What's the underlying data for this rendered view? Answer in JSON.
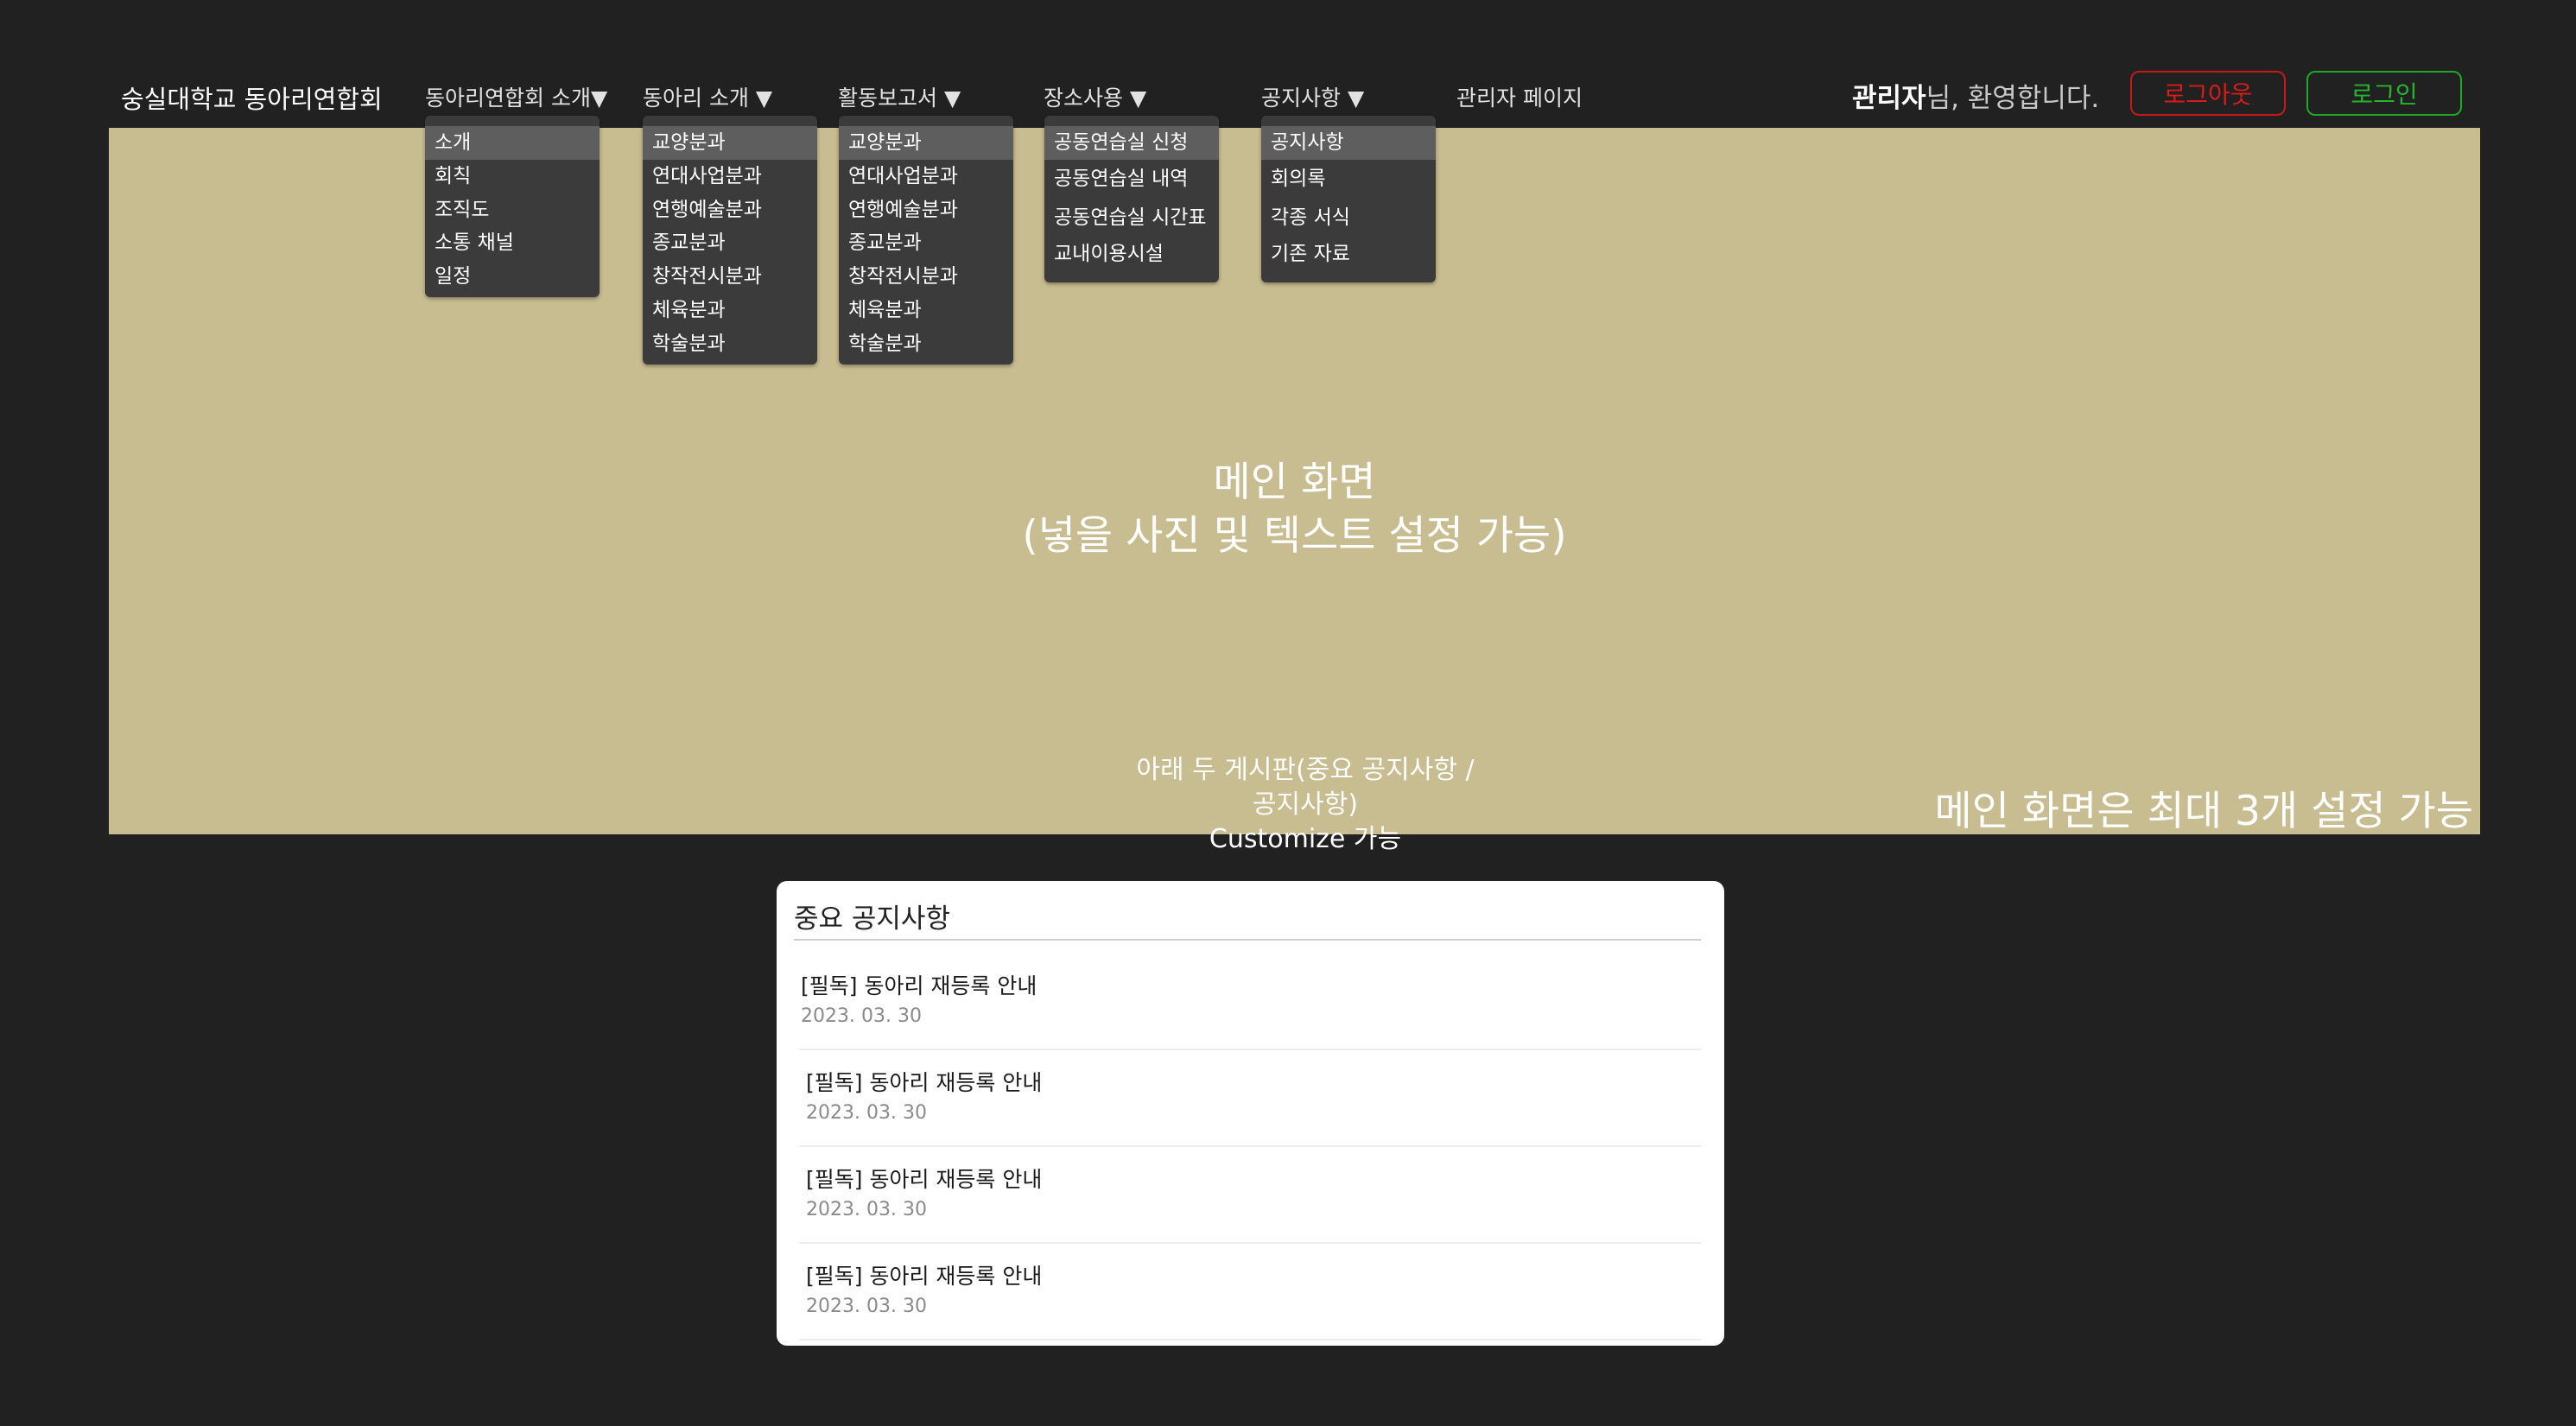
{
  "header": {
    "logo": "숭실대학교 동아리연합회",
    "nav": [
      {
        "label": "동아리연합회 소개▼"
      },
      {
        "label": "동아리 소개 ▼"
      },
      {
        "label": "활동보고서 ▼"
      },
      {
        "label": "장소사용 ▼"
      },
      {
        "label": "공지사항 ▼"
      },
      {
        "label": "관리자 페이지"
      }
    ],
    "welcome_name": "관리자",
    "welcome_suffix": "님, 환영합니다.",
    "logout_label": "로그아웃",
    "login_label": "로그인"
  },
  "dropdowns": {
    "intro": [
      "소개",
      "회칙",
      "조직도",
      "소통 채널",
      "일정"
    ],
    "clubs": [
      "교양분과",
      "연대사업분과",
      "연행예술분과",
      "종교분과",
      "창작전시분과",
      "체육분과",
      "학술분과"
    ],
    "reports": [
      "교양분과",
      "연대사업분과",
      "연행예술분과",
      "종교분과",
      "창작전시분과",
      "체육분과",
      "학술분과"
    ],
    "places": [
      "공동연습실 신청",
      "공동연습실 내역",
      "공동연습실 시간표",
      "교내이용시설"
    ],
    "notices": [
      "공지사항",
      "회의록",
      "각종 서식",
      "기존 자료"
    ]
  },
  "hero": {
    "main_line1": "메인 화면",
    "main_line2": "(넣을 사진 및 텍스트 설정 가능)",
    "note_line1": "아래 두 게시판(중요 공지사항 / 공지사항)",
    "note_line2": "Customize 가능",
    "corner": "메인 화면은 최대 3개 설정 가능",
    "bg_color": "#c8bc91"
  },
  "important_notices": {
    "title": "중요 공지사항",
    "items": [
      {
        "title": "[필독] 동아리 재등록 안내",
        "date": "2023. 03. 30"
      },
      {
        "title": "[필독] 동아리 재등록 안내",
        "date": "2023. 03. 30"
      },
      {
        "title": "[필독] 동아리 재등록 안내",
        "date": "2023. 03. 30"
      },
      {
        "title": "[필독] 동아리 재등록 안내",
        "date": "2023. 03. 30"
      }
    ]
  },
  "colors": {
    "background": "#212121",
    "logout": "#d81c1c",
    "login": "#25b52a",
    "dropdown_bg": "#3b3b3b",
    "dropdown_active": "#5e5e5e"
  }
}
